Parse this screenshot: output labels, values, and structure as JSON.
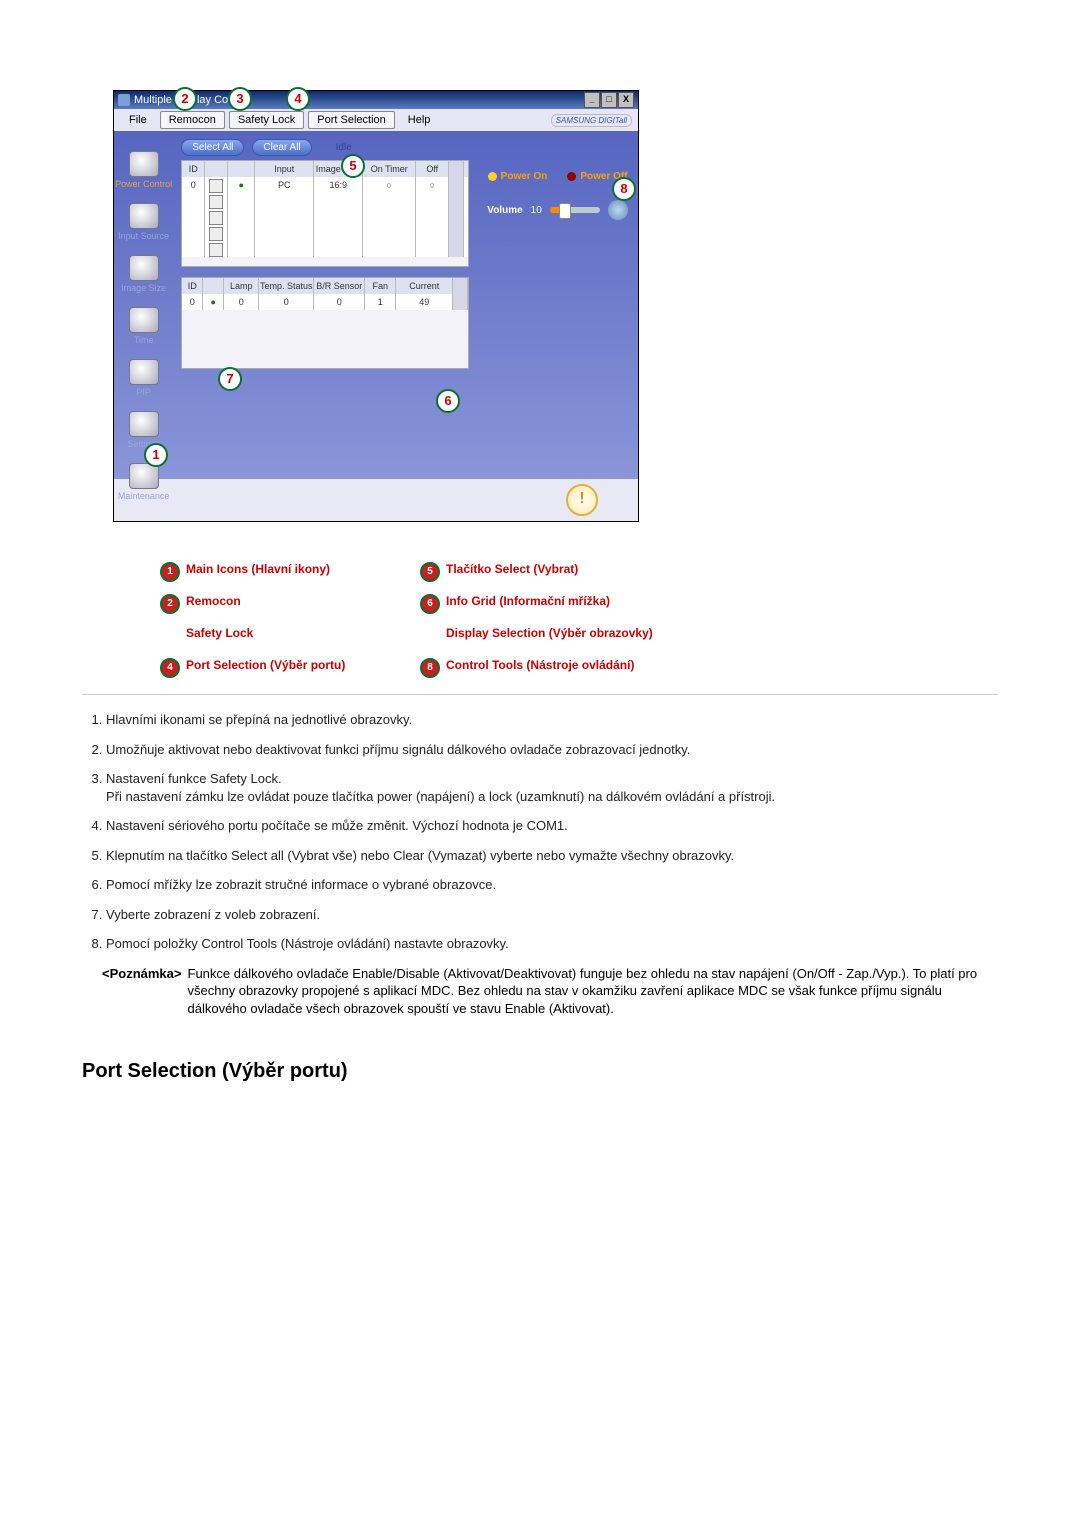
{
  "app": {
    "title": "Multiple Display Control",
    "brand": "SAMSUNG DIGITall"
  },
  "menu": {
    "file": "File",
    "remocon": "Remocon",
    "safety_lock": "Safety Lock",
    "port_selection": "Port Selection",
    "help": "Help"
  },
  "toolbar": {
    "select_all": "Select All",
    "clear_all": "Clear All",
    "idle_label": "Idle"
  },
  "sidebar": {
    "items": [
      {
        "label": "Power Control",
        "muted": false
      },
      {
        "label": "Input Source",
        "muted": true
      },
      {
        "label": "Image Size",
        "muted": true
      },
      {
        "label": "Time",
        "muted": true
      },
      {
        "label": "PIP",
        "muted": true
      },
      {
        "label": "Settings",
        "muted": true
      },
      {
        "label": "Maintenance",
        "muted": true
      }
    ]
  },
  "grid_top": {
    "headers": [
      "ID",
      "",
      "",
      "Input",
      "Image Size",
      "On Timer",
      "Off Timer"
    ],
    "rows": [
      {
        "id": "0",
        "remote_on": true,
        "input": "PC",
        "image_size": "16:9",
        "on_timer": "○",
        "off_timer": "○"
      }
    ]
  },
  "grid_bottom": {
    "headers": [
      "ID",
      "",
      "Lamp",
      "Temp. Status",
      "B/R Sensor",
      "Fan",
      "Current Temp."
    ],
    "rows": [
      {
        "id": "0",
        "lamp": "0",
        "temp_status": "0",
        "br_sensor": "0",
        "fan": "1",
        "current_temp": "49"
      }
    ]
  },
  "right_panel": {
    "power_on": "Power On",
    "power_off": "Power Off",
    "volume_label": "Volume",
    "volume_value": "10"
  },
  "legend": {
    "items": [
      {
        "num": "1",
        "text": "Main Icons (Hlavní ikony)"
      },
      {
        "num": "5",
        "text": "Tlačítko Select (Vybrat)"
      },
      {
        "num": "2",
        "text": "Remocon"
      },
      {
        "num": "6",
        "text": "Info Grid (Informační mřížka)"
      },
      {
        "num": "",
        "text": "Safety Lock"
      },
      {
        "num": "",
        "text": "Display Selection (Výběr obrazovky)"
      },
      {
        "num": "4",
        "text": "Port Selection (Výběr portu)"
      },
      {
        "num": "8",
        "text": "Control Tools (Nástroje ovládání)"
      }
    ]
  },
  "desc_list": [
    "Hlavními ikonami se přepíná na jednotlivé obrazovky.",
    "Umožňuje aktivovat nebo deaktivovat funkci příjmu signálu dálkového ovladače zobrazovací jednotky.",
    "Nastavení funkce Safety Lock.\nPři nastavení zámku lze ovládat pouze tlačítka power (napájení) a lock (uzamknutí) na dálkovém ovládání a přístroji.",
    "Nastavení sériového portu počítače se může změnit. Výchozí hodnota je COM1.",
    "Klepnutím na tlačítko Select all (Vybrat vše) nebo Clear (Vymazat) vyberte nebo vymažte všechny obrazovky.",
    "Pomocí mřížky lze zobrazit stručné informace o vybrané obrazovce.",
    "Vyberte zobrazení z voleb zobrazení.",
    "Pomocí položky Control Tools (Nástroje ovládání) nastavte obrazovky."
  ],
  "note": {
    "label": "<Poznámka>",
    "body": "Funkce dálkového ovladače Enable/Disable (Aktivovat/Deaktivovat) funguje bez ohledu na stav napájení (On/Off - Zap./Vyp.). To platí pro všechny obrazovky propojené s aplikací MDC. Bez ohledu na stav v okamžiku zavření aplikace MDC se však funkce příjmu signálu dálkového ovladače všech obrazovek spouští ve stavu Enable (Aktivovat)."
  },
  "section_heading": "Port Selection (Výběr portu)"
}
